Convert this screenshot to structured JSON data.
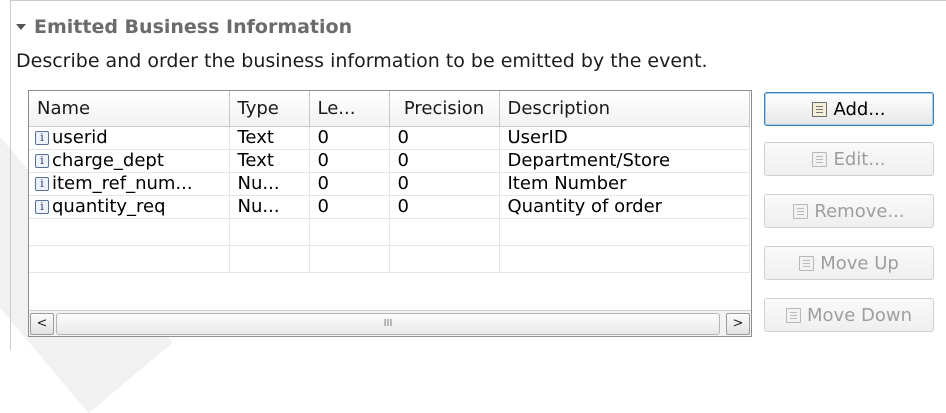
{
  "section": {
    "title": "Emitted Business Information",
    "description": "Describe and order the business information to be emitted by the event."
  },
  "table": {
    "columns": [
      "Name",
      "Type",
      "Le...",
      "Precision",
      "Description"
    ],
    "rows": [
      {
        "name": "userid",
        "type": "Text",
        "length": "0",
        "precision": "0",
        "description": "UserID"
      },
      {
        "name": "charge_dept",
        "type": "Text",
        "length": "0",
        "precision": "0",
        "description": "Department/Store"
      },
      {
        "name": "item_ref_num...",
        "type": "Nu...",
        "length": "0",
        "precision": "0",
        "description": "Item Number"
      },
      {
        "name": "quantity_req",
        "type": "Nu...",
        "length": "0",
        "precision": "0",
        "description": "Quantity of order"
      }
    ],
    "row_icon": "info-icon",
    "scrollbar": {
      "left_arrow": "<",
      "right_arrow": ">",
      "thumb_grip": "III"
    }
  },
  "buttons": {
    "add": {
      "label": "Add...",
      "enabled": true
    },
    "edit": {
      "label": "Edit...",
      "enabled": false
    },
    "remove": {
      "label": "Remove...",
      "enabled": false
    },
    "move_up": {
      "label": "Move Up",
      "enabled": false
    },
    "move_down": {
      "label": "Move Down",
      "enabled": false
    }
  }
}
